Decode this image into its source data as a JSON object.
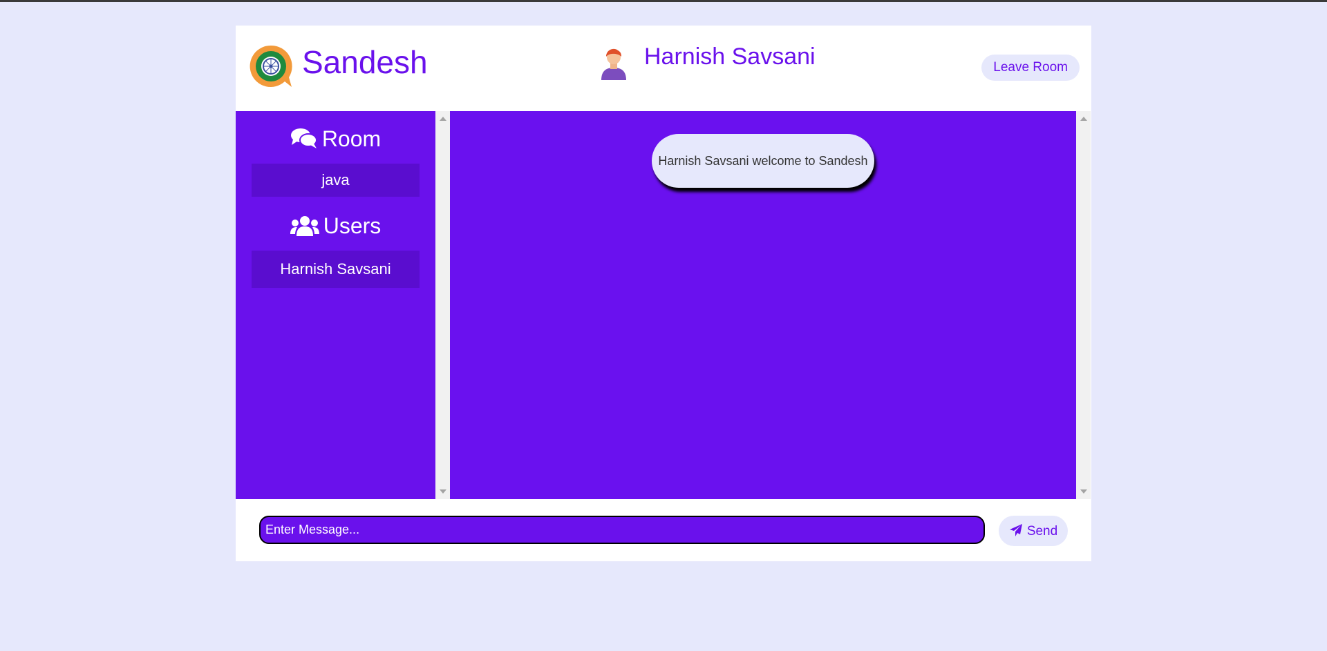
{
  "header": {
    "brand_name": "Sandesh",
    "current_user": "Harnish Savsani",
    "leave_room_label": "Leave Room"
  },
  "sidebar": {
    "room_heading": "Room",
    "room_name": "java",
    "users_heading": "Users",
    "users": [
      "Harnish Savsani"
    ]
  },
  "chat": {
    "messages": [
      {
        "text": "Harnish Savsani welcome to Sandesh"
      }
    ]
  },
  "composer": {
    "placeholder": "Enter Message...",
    "value": "",
    "send_label": "Send"
  },
  "colors": {
    "accent": "#6a11ec",
    "background": "#e6e8fc",
    "panel": "#ffffff"
  },
  "icons": {
    "logo": "chat-bubble-wheel-icon",
    "avatar": "user-avatar-icon",
    "room": "comments-icon",
    "users": "users-icon",
    "send": "paper-plane-icon"
  }
}
